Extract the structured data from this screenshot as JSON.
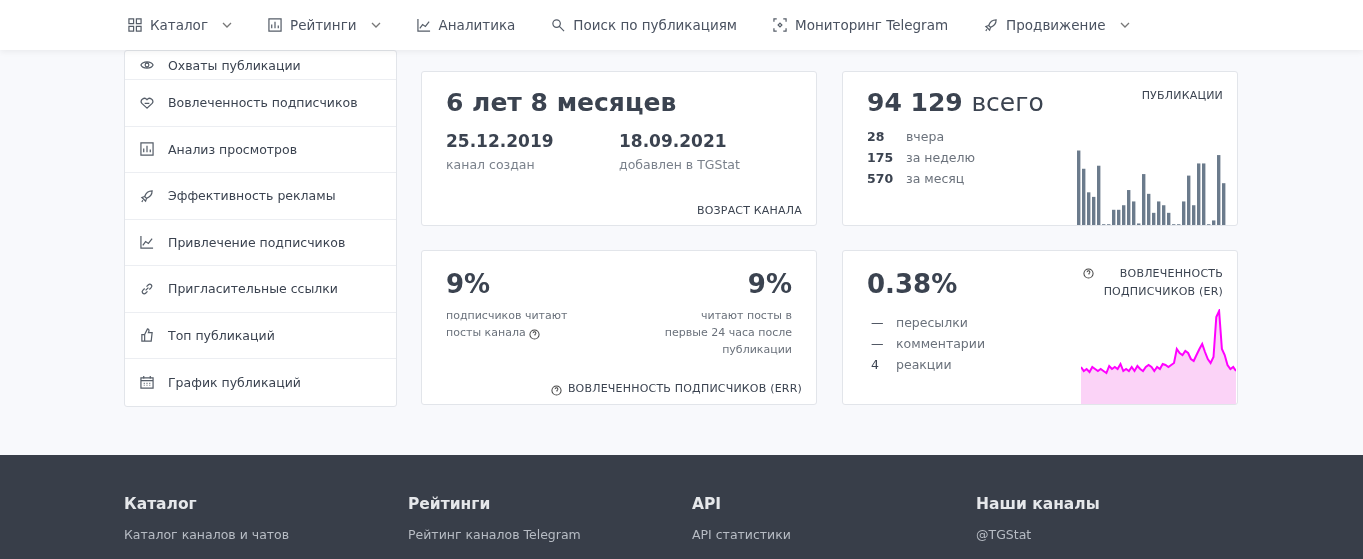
{
  "nav": [
    {
      "label": "Каталог",
      "dropdown": true
    },
    {
      "label": "Рейтинги",
      "dropdown": true
    },
    {
      "label": "Аналитика",
      "dropdown": false
    },
    {
      "label": "Поиск по публикациям",
      "dropdown": false
    },
    {
      "label": "Мониторинг Telegram",
      "dropdown": false
    },
    {
      "label": "Продвижение",
      "dropdown": true
    }
  ],
  "sidebar": {
    "items": [
      {
        "label": "Охваты публикации"
      },
      {
        "label": "Вовлеченность подписчиков"
      },
      {
        "label": "Анализ просмотров"
      },
      {
        "label": "Эффективность рекламы"
      },
      {
        "label": "Привлечение подписчиков"
      },
      {
        "label": "Пригласительные ссылки"
      },
      {
        "label": "Топ публикаций"
      },
      {
        "label": "График публикаций"
      }
    ]
  },
  "age_card": {
    "value": "6 лет 8 месяцев",
    "dates": [
      {
        "value": "25.12.2019",
        "label": "канал создан"
      },
      {
        "value": "18.09.2021",
        "label": "добавлен в TGStat"
      }
    ],
    "caption": "ВОЗРАСТ КАНАЛА"
  },
  "posts_card": {
    "total": "94 129",
    "total_suffix": "всего",
    "caption": "ПУБЛИКАЦИИ",
    "stats": [
      {
        "value": "28",
        "label": "вчера"
      },
      {
        "value": "175",
        "label": "за неделю"
      },
      {
        "value": "570",
        "label": "за месяц"
      }
    ]
  },
  "err_card": {
    "left": {
      "value": "9%",
      "label": "подписчиков читают посты канала"
    },
    "right": {
      "value": "9%",
      "label": "читают посты в первые 24 часа после публикации"
    },
    "caption": "ВОВЛЕЧЕННОСТЬ ПОДПИСЧИКОВ (ERR)"
  },
  "er_card": {
    "value": "0.38%",
    "caption": "ВОВЛЕЧЕННОСТЬ ПОДПИСЧИКОВ (ER)",
    "stats": [
      {
        "value": "—",
        "label": "пересылки"
      },
      {
        "value": "—",
        "label": "комментарии"
      },
      {
        "value": "4",
        "label": "реакции"
      }
    ]
  },
  "footer": {
    "columns": [
      {
        "title": "Каталог",
        "link": "Каталог каналов и чатов"
      },
      {
        "title": "Рейтинги",
        "link": "Рейтинг каналов Telegram"
      },
      {
        "title": "API",
        "link": "API статистики"
      },
      {
        "title": "Наши каналы",
        "link": "@TGStat"
      }
    ]
  }
}
